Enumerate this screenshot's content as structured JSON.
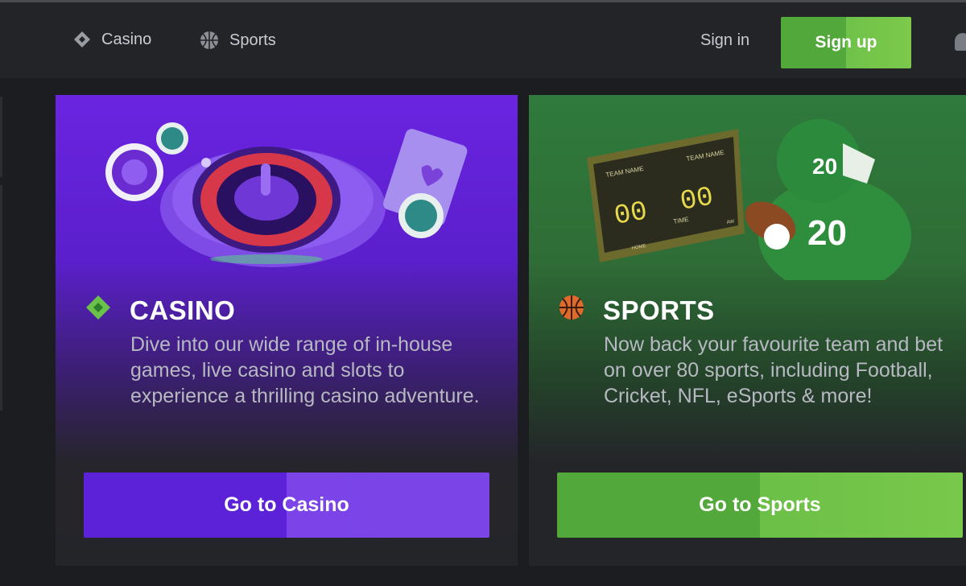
{
  "header": {
    "nav": [
      {
        "label": "Casino",
        "icon": "casino-diamond-icon"
      },
      {
        "label": "Sports",
        "icon": "basketball-icon"
      }
    ],
    "sign_in_label": "Sign in",
    "sign_up_label": "Sign up"
  },
  "cards": {
    "casino": {
      "title": "CASINO",
      "description": "Dive into our wide range of in-house games, live casino and slots to experience a thrilling casino adventure.",
      "button_label": "Go to Casino",
      "icon": "casino-diamond-icon"
    },
    "sports": {
      "title": "SPORTS",
      "description": "Now back your favourite team and bet on over 80 sports, including Football, Cricket, NFL, eSports & more!",
      "button_label": "Go to Sports",
      "icon": "basketball-icon",
      "scoreboard": {
        "team_a": "TEAM NAME",
        "team_b": "TEAM NAME",
        "score_a": "00",
        "score_b": "00",
        "time_label": "TIME",
        "home_label": "HOME",
        "away_label": "AW"
      },
      "jersey_number": "20"
    }
  },
  "colors": {
    "casino_accent": "#5c22d8",
    "sports_accent": "#52a83a",
    "background": "#1c1d21"
  }
}
